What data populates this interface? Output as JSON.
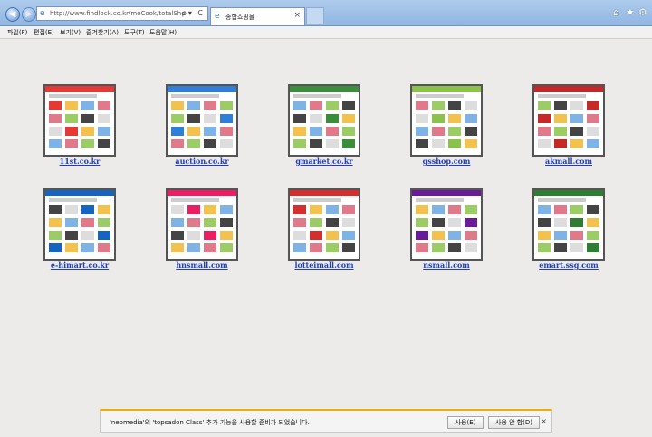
{
  "browser": {
    "url": "http://www.findlock.co.kr/moCook/totalShowShop.j",
    "tab_title": "종합쇼핑몰",
    "address_buttons": "ρ▾ C"
  },
  "menu": [
    "파일(F)",
    "편집(E)",
    "보기(V)",
    "즐겨찾기(A)",
    "도구(T)",
    "도움말(H)"
  ],
  "sites": [
    {
      "label": "11st.co.kr",
      "color": "#e53935"
    },
    {
      "label": "auction.co.kr",
      "color": "#2f7fd8"
    },
    {
      "label": "gmarket.co.kr",
      "color": "#3a8e3a"
    },
    {
      "label": "gsshop.com",
      "color": "#8bc34a"
    },
    {
      "label": "akmall.com",
      "color": "#c62828"
    },
    {
      "label": "e-himart.co.kr",
      "color": "#1565c0"
    },
    {
      "label": "hnsmall.com",
      "color": "#e91e63"
    },
    {
      "label": "lotteimall.com",
      "color": "#d32f2f"
    },
    {
      "label": "nsmall.com",
      "color": "#6a1b9a"
    },
    {
      "label": "emart.ssg.com",
      "color": "#2e7d32"
    }
  ],
  "notification": {
    "message": "'neomedia'의 'topsadon Class' 추가 기능을 사용할 준비가 되었습니다.",
    "enable_label": "사용(E)",
    "disable_label": "사용 안 함(D)"
  }
}
